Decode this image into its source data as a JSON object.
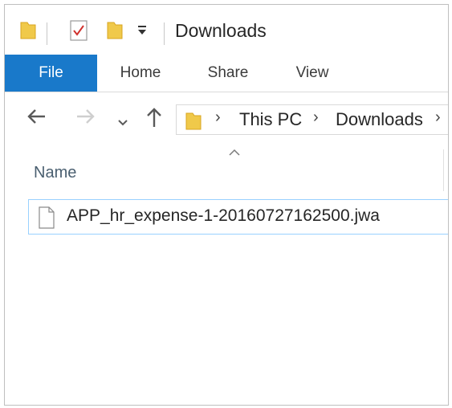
{
  "window": {
    "title": "Downloads"
  },
  "ribbon": {
    "tabs": [
      {
        "label": "File",
        "active": true
      },
      {
        "label": "Home"
      },
      {
        "label": "Share"
      },
      {
        "label": "View"
      }
    ]
  },
  "nav": {
    "back_icon": "back-arrow-icon",
    "forward_icon": "forward-arrow-icon",
    "recent_icon": "chevron-down-icon",
    "up_icon": "up-arrow-icon"
  },
  "breadcrumb": {
    "items": [
      {
        "label": "This PC"
      },
      {
        "label": "Downloads"
      }
    ]
  },
  "columns": {
    "name": "Name"
  },
  "files": [
    {
      "name": "APP_hr_expense-1-20160727162500.jwa",
      "icon": "document-icon"
    }
  ],
  "colors": {
    "accent": "#1979ca",
    "selection_border": "#99d1ff",
    "folder": "#f0c94a"
  }
}
